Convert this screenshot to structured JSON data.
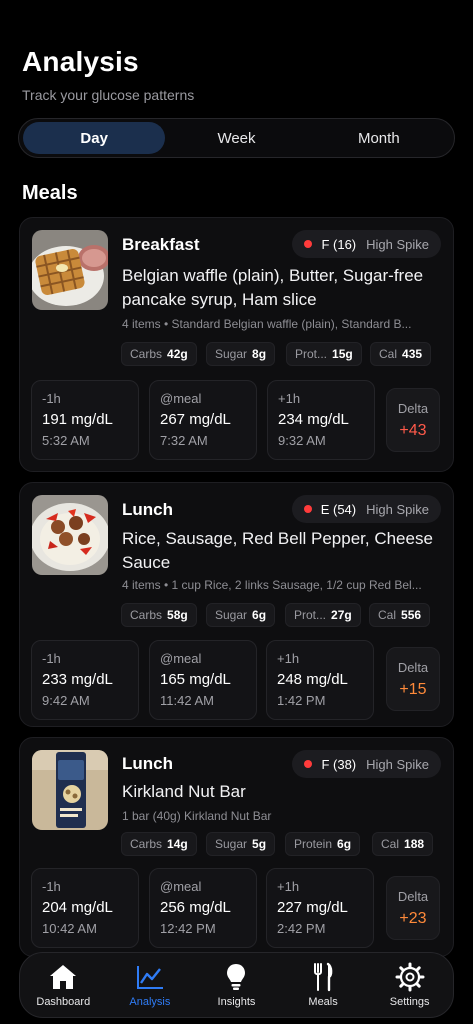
{
  "header": {
    "title": "Analysis",
    "subtitle": "Track your glucose patterns"
  },
  "tabs": [
    {
      "label": "Day",
      "active": true
    },
    {
      "label": "Week",
      "active": false
    },
    {
      "label": "Month",
      "active": false
    }
  ],
  "section_title": "Meals",
  "meals": [
    {
      "name": "Breakfast",
      "grade": "F (16)",
      "spike": "High Spike",
      "foods": "Belgian waffle (plain), Butter, Sugar-free pancake syrup, Ham slice",
      "items": "4 items • Standard Belgian waffle (plain), Standard B...",
      "carbs_label": "Carbs",
      "carbs": "42g",
      "sugar_label": "Sugar",
      "sugar": "8g",
      "protein_label": "Prot...",
      "protein": "15g",
      "cal_label": "Cal",
      "cal": "435",
      "before_label": "-1h",
      "before_value": "191 mg/dL",
      "before_time": "5:32 AM",
      "meal_label": "@meal",
      "meal_value": "267 mg/dL",
      "meal_time": "7:32 AM",
      "after_label": "+1h",
      "after_value": "234 mg/dL",
      "after_time": "9:32 AM",
      "delta_label": "Delta",
      "delta": "+43",
      "delta_color": "#ff5a4a"
    },
    {
      "name": "Lunch",
      "grade": "E (54)",
      "spike": "High Spike",
      "foods": "Rice, Sausage, Red Bell Pepper, Cheese Sauce",
      "items": "4 items • 1 cup Rice, 2 links Sausage, 1/2 cup Red Bel...",
      "carbs_label": "Carbs",
      "carbs": "58g",
      "sugar_label": "Sugar",
      "sugar": "6g",
      "protein_label": "Prot...",
      "protein": "27g",
      "cal_label": "Cal",
      "cal": "556",
      "before_label": "-1h",
      "before_value": "233 mg/dL",
      "before_time": "9:42 AM",
      "meal_label": "@meal",
      "meal_value": "165 mg/dL",
      "meal_time": "11:42 AM",
      "after_label": "+1h",
      "after_value": "248 mg/dL",
      "after_time": "1:42 PM",
      "delta_label": "Delta",
      "delta": "+15",
      "delta_color": "#ff8a3a"
    },
    {
      "name": "Lunch",
      "grade": "F (38)",
      "spike": "High Spike",
      "foods": "Kirkland Nut Bar",
      "items": "1 bar (40g) Kirkland Nut Bar",
      "carbs_label": "Carbs",
      "carbs": "14g",
      "sugar_label": "Sugar",
      "sugar": "5g",
      "protein_label": "Protein",
      "protein": "6g",
      "cal_label": "Cal",
      "cal": "188",
      "before_label": "-1h",
      "before_value": "204 mg/dL",
      "before_time": "10:42 AM",
      "meal_label": "@meal",
      "meal_value": "256 mg/dL",
      "meal_time": "12:42 PM",
      "after_label": "+1h",
      "after_value": "227 mg/dL",
      "after_time": "2:42 PM",
      "delta_label": "Delta",
      "delta": "+23",
      "delta_color": "#ff8a3a"
    }
  ],
  "nav": [
    {
      "label": "Dashboard",
      "icon": "house-icon",
      "active": false
    },
    {
      "label": "Analysis",
      "icon": "chart-line-icon",
      "active": true
    },
    {
      "label": "Insights",
      "icon": "lightbulb-icon",
      "active": false
    },
    {
      "label": "Meals",
      "icon": "fork-knife-icon",
      "active": false
    },
    {
      "label": "Settings",
      "icon": "gear-icon",
      "active": false
    }
  ],
  "colors": {
    "accent": "#2f7cf6",
    "active_tab": "#1b2f4d",
    "spike_dot": "#ff3b3b"
  }
}
